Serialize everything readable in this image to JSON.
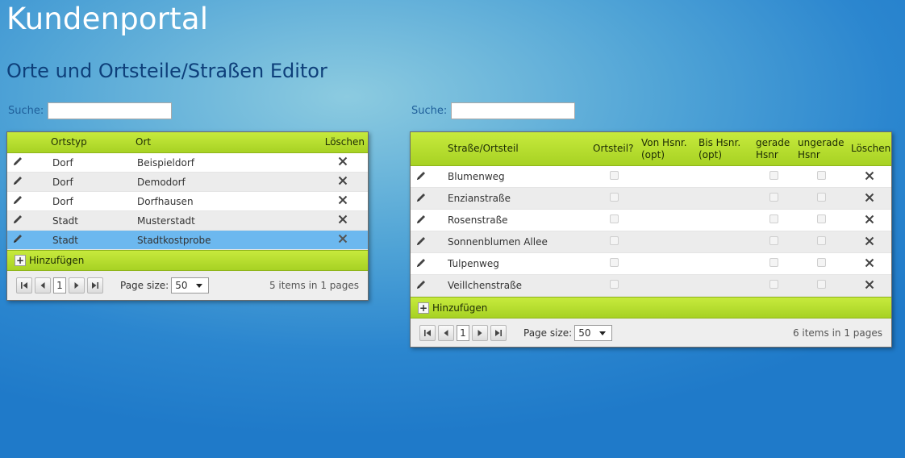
{
  "app": {
    "title": "Kundenportal"
  },
  "page": {
    "title": "Orte und Ortsteile/Straßen Editor"
  },
  "left": {
    "search_label": "Suche:",
    "search_value": "",
    "columns": {
      "type": "Ortstyp",
      "place": "Ort",
      "delete": "Löschen"
    },
    "rows": [
      {
        "type": "Dorf",
        "place": "Beispieldorf"
      },
      {
        "type": "Dorf",
        "place": "Demodorf"
      },
      {
        "type": "Dorf",
        "place": "Dorfhausen"
      },
      {
        "type": "Stadt",
        "place": "Musterstadt"
      },
      {
        "type": "Stadt",
        "place": "Stadtkostprobe"
      }
    ],
    "add_label": "Hinzufügen",
    "page_number": "1",
    "page_size_label": "Page size:",
    "page_size_value": "50",
    "info": "5 items in 1 pages"
  },
  "right": {
    "search_label": "Suche:",
    "search_value": "",
    "columns": {
      "street": "Straße/Ortsteil",
      "district": "Ortsteil?",
      "from_1": "Von Hsnr.",
      "from_2": "(opt)",
      "to_1": "Bis Hsnr.",
      "to_2": "(opt)",
      "even_1": "gerade",
      "even_2": "Hsnr",
      "odd_1": "ungerade",
      "odd_2": "Hsnr",
      "delete": "Löschen"
    },
    "rows": [
      {
        "street": "Blumenweg"
      },
      {
        "street": "Enzianstraße"
      },
      {
        "street": "Rosenstraße"
      },
      {
        "street": "Sonnenblumen Allee"
      },
      {
        "street": "Tulpenweg"
      },
      {
        "street": "Veillchenstraße"
      }
    ],
    "add_label": "Hinzufügen",
    "page_number": "1",
    "page_size_label": "Page size:",
    "page_size_value": "50",
    "info": "6 items in 1 pages"
  },
  "icons": {
    "edit": "pencil-icon",
    "delete": "x-icon",
    "add": "plus-icon"
  },
  "colors": {
    "header_green": "#b3dc2c",
    "selected_row": "#6cb8ef",
    "title_blue": "#0e3f7a"
  }
}
